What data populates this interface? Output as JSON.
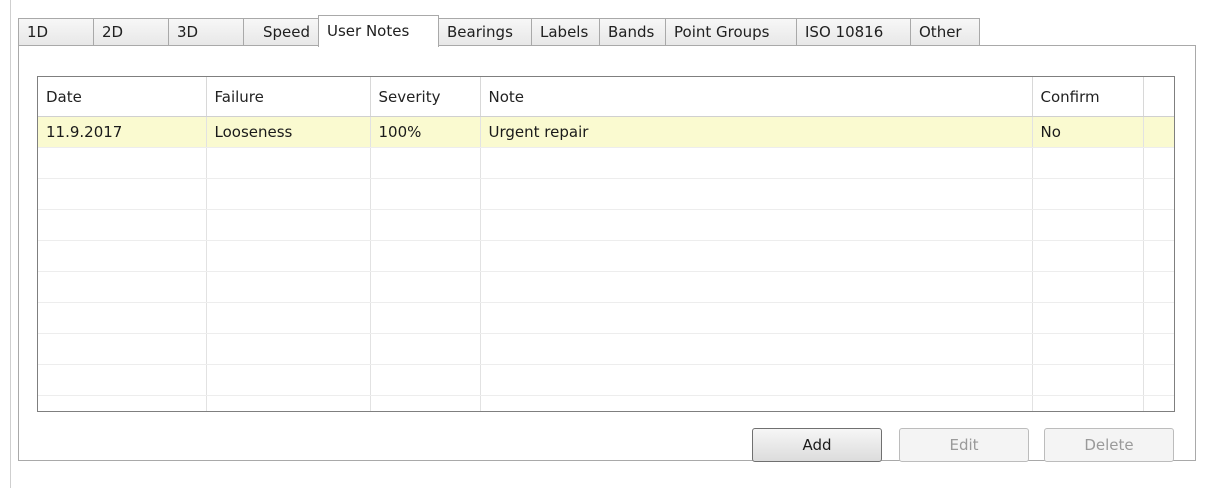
{
  "tabs": [
    {
      "label": "1D"
    },
    {
      "label": "2D"
    },
    {
      "label": "3D"
    },
    {
      "label": "Speed"
    },
    {
      "label": "User Notes",
      "active": true
    },
    {
      "label": "Bearings"
    },
    {
      "label": "Labels"
    },
    {
      "label": "Bands"
    },
    {
      "label": "Point Groups"
    },
    {
      "label": "ISO 10816"
    },
    {
      "label": "Other"
    }
  ],
  "notes_table": {
    "columns": [
      "Date",
      "Failure",
      "Severity",
      "Note",
      "Confirm"
    ],
    "rows": [
      {
        "date": "11.9.2017",
        "failure": "Looseness",
        "severity": "100%",
        "note": "Urgent repair",
        "confirm": "No",
        "selected": true
      }
    ]
  },
  "buttons": {
    "add": {
      "label": "Add",
      "enabled": true
    },
    "edit": {
      "label": "Edit",
      "enabled": false
    },
    "delete": {
      "label": "Delete",
      "enabled": false
    }
  },
  "colors": {
    "selected_row": "#fafad0",
    "border": "#a9a9a9"
  }
}
